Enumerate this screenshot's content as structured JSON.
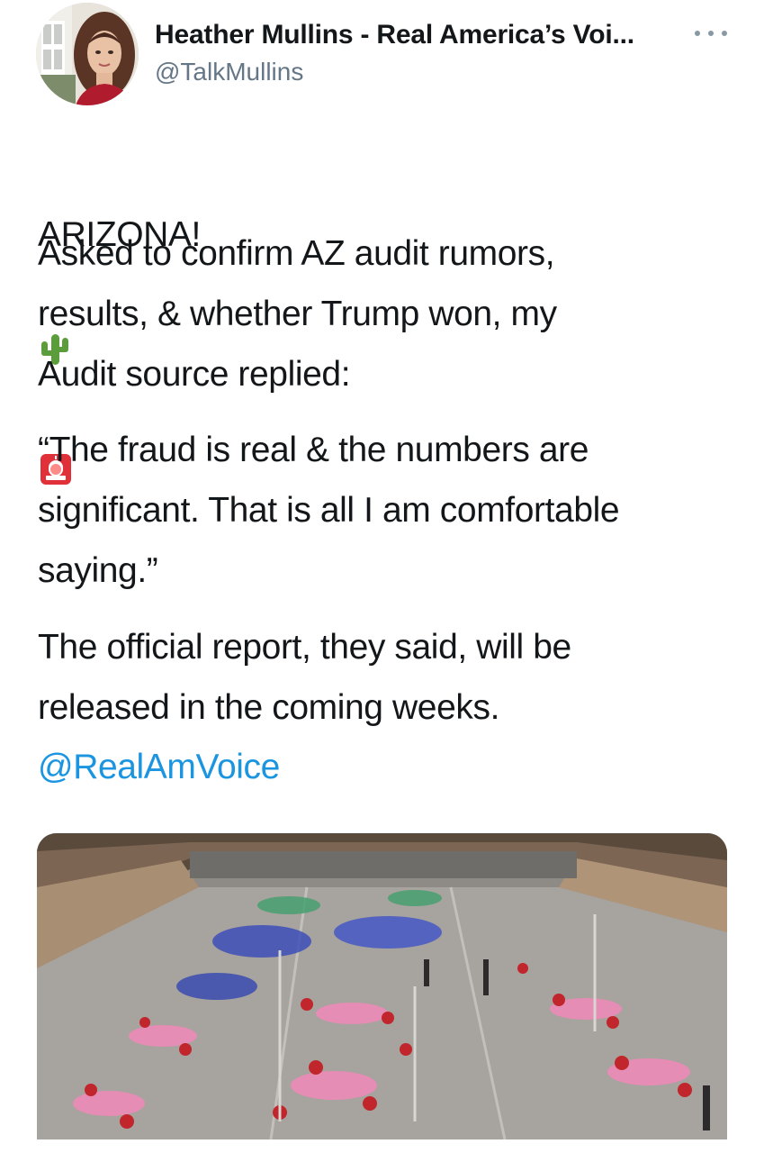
{
  "tweet": {
    "author": {
      "name": "Heather Mullins - Real America’s Voi...",
      "handle": "@TalkMullins",
      "avatar_icon": "profile-photo"
    },
    "more_icon": "ellipsis-icon",
    "headline": "ARIZONA!",
    "headline_emojis": [
      "cactus-icon",
      "police-light-icon"
    ],
    "paragraph1": "Asked to confirm AZ audit rumors,\nresults, & whether Trump won, my\nAudit source replied:",
    "paragraph2": " “The fraud is real & the numbers are\nsignificant. That is all I am comfortable\nsaying.”",
    "paragraph3": "The official report, they said, will be\nreleased in the coming weeks.",
    "mention": "@RealAmVoice",
    "colors": {
      "text": "#14171a",
      "secondary": "#657786",
      "link": "#1b95e0"
    }
  }
}
